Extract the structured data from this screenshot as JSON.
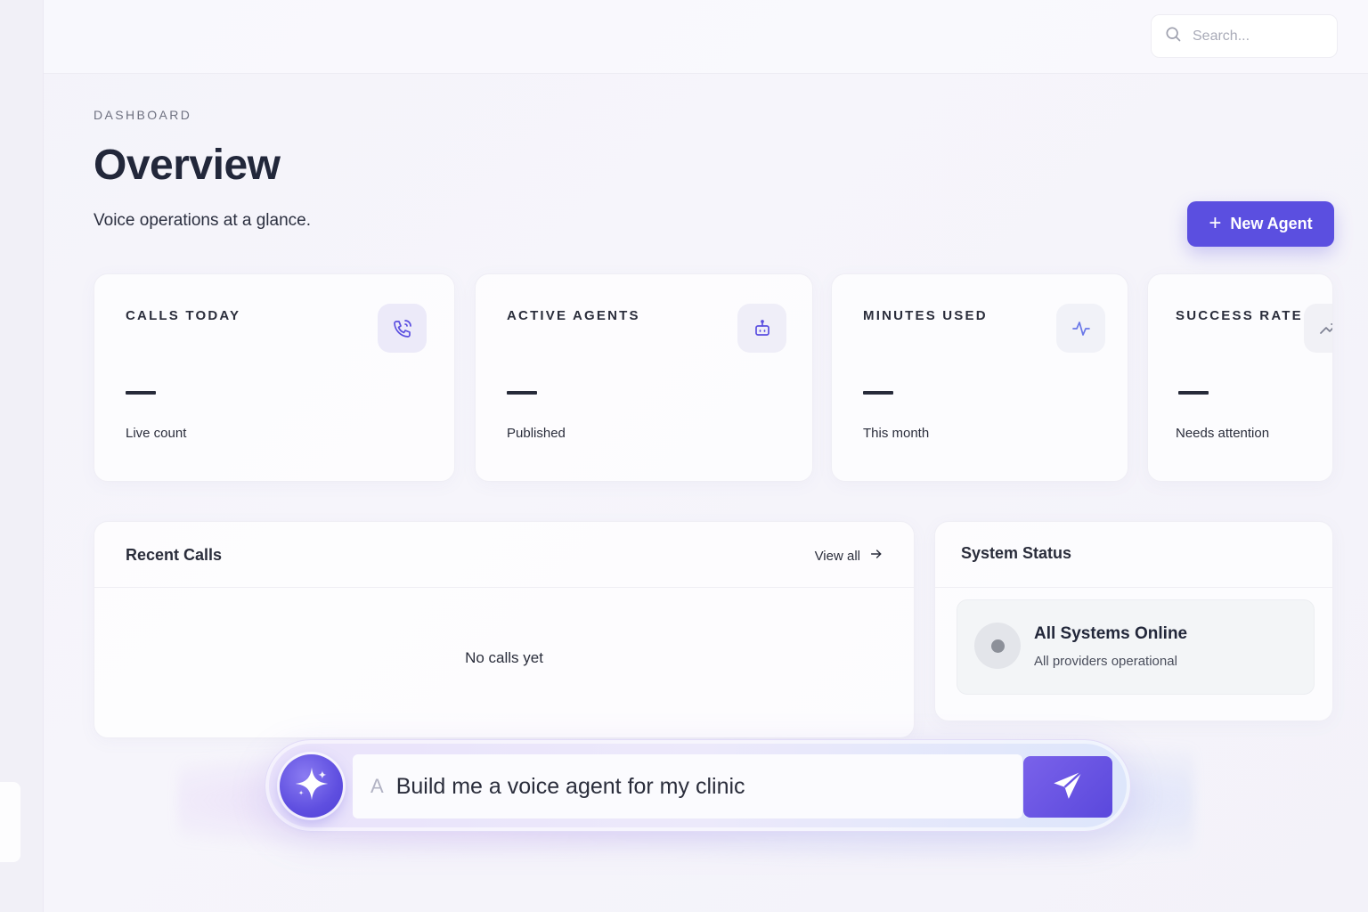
{
  "search": {
    "placeholder": "Search..."
  },
  "header": {
    "eyebrow": "DASHBOARD",
    "title": "Overview",
    "subtitle": "Voice operations at a glance."
  },
  "actions": {
    "new_agent": "New Agent"
  },
  "stats": [
    {
      "label": "CALLS TODAY",
      "value": "—",
      "sub": "Live count",
      "icon": "phone-icon"
    },
    {
      "label": "ACTIVE AGENTS",
      "value": "—",
      "sub": "Published",
      "icon": "bot-icon"
    },
    {
      "label": "MINUTES USED",
      "value": "—",
      "sub": "This month",
      "icon": "activity-icon"
    },
    {
      "label": "SUCCESS RATE",
      "value": "—",
      "sub": "Needs attention",
      "icon": "trending-up-icon"
    }
  ],
  "recent_calls": {
    "title": "Recent Calls",
    "view_all": "View all",
    "empty": "No calls yet"
  },
  "system_status": {
    "title": "System Status",
    "status_title": "All Systems Online",
    "status_sub": "All providers operational"
  },
  "prompt": {
    "value": "Build me a voice agent for my clinic",
    "cursor_glyph": "A"
  },
  "colors": {
    "accent": "#5b4fe0",
    "background": "#f4f3fa",
    "text": "#22273a"
  }
}
